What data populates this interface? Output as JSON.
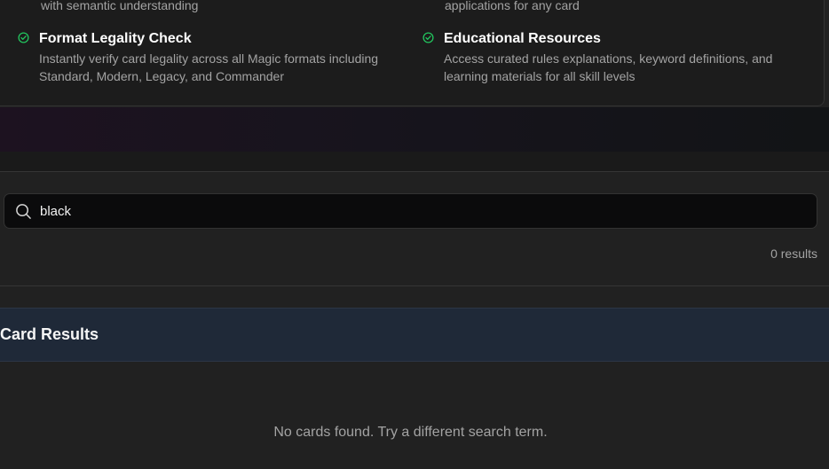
{
  "features": {
    "partial_left": "with semantic understanding",
    "partial_right": "applications for any card",
    "items": [
      {
        "title": "Format Legality Check",
        "description": "Instantly verify card legality across all Magic formats including Standard, Modern, Legacy, and Commander"
      },
      {
        "title": "Educational Resources",
        "description": "Access curated rules explanations, keyword definitions, and learning materials for all skill levels"
      }
    ],
    "check_color": "#22c55e"
  },
  "search": {
    "value": "black",
    "icon": "search-icon",
    "results_count": "0 results"
  },
  "results": {
    "heading": "Card Results",
    "empty_message": "No cards found. Try a different search term."
  }
}
